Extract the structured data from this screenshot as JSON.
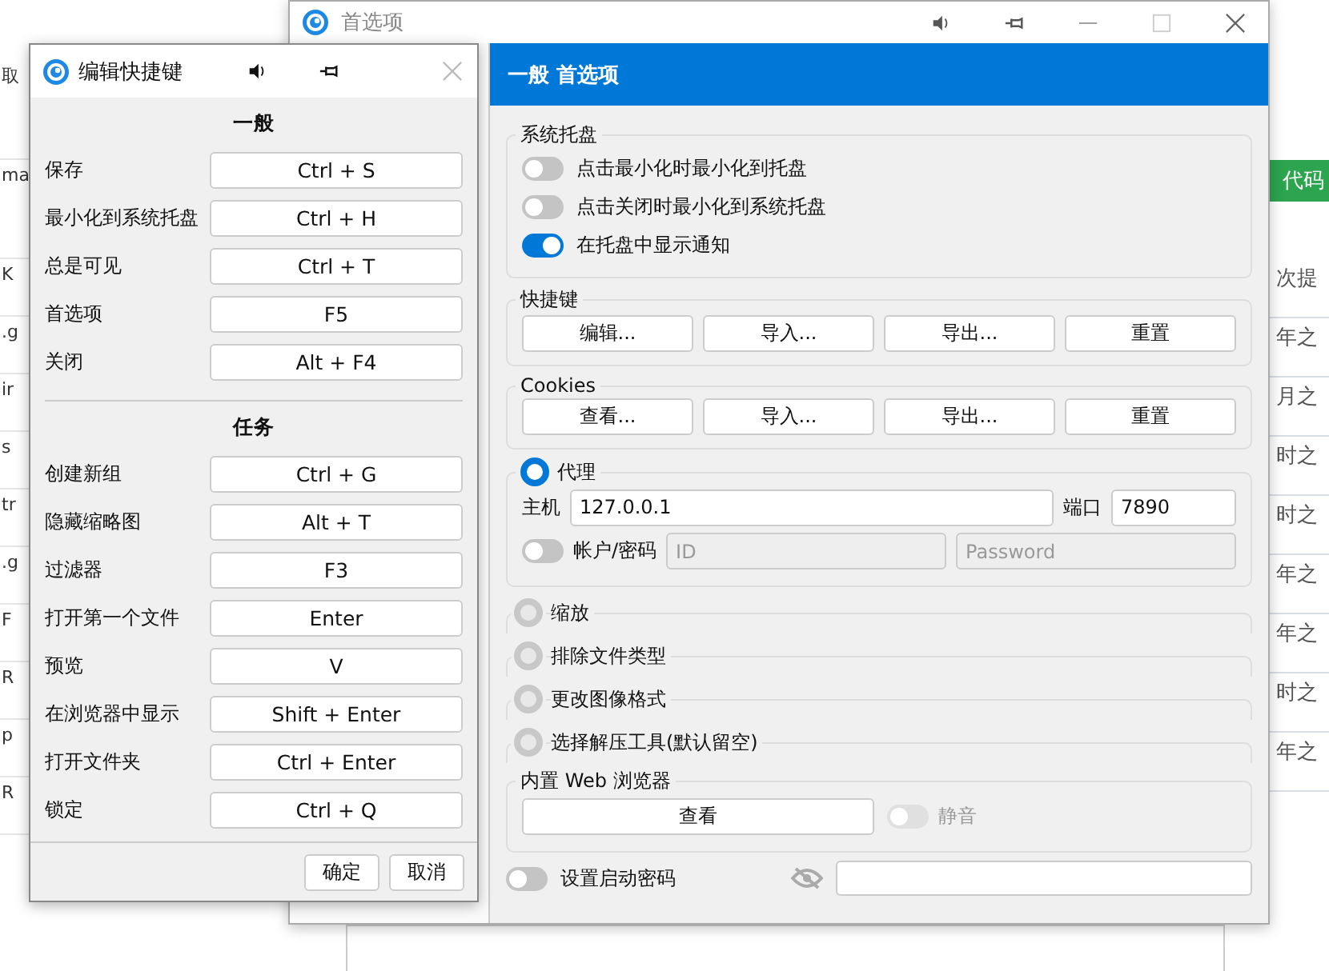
{
  "background_page": {
    "left_fragments": [
      "取",
      "ma",
      "K",
      ".g",
      "ir",
      "s",
      "tr",
      ".g",
      "F",
      "R",
      "p",
      "R"
    ],
    "code_button": "代码",
    "right_fragments": [
      "次提",
      "年之",
      "月之",
      "时之",
      "时之",
      "年之",
      "年之",
      "时之",
      "年之"
    ]
  },
  "preferences_window": {
    "title": "首选项",
    "header": "一般 首选项",
    "groups": [
      {
        "kind": "toggles",
        "legend": "系统托盘",
        "items": [
          {
            "label": "点击最小化时最小化到托盘",
            "on": false
          },
          {
            "label": "点击关闭时最小化到系统托盘",
            "on": false
          },
          {
            "label": "在托盘中显示通知",
            "on": true
          }
        ]
      },
      {
        "kind": "buttons",
        "legend": "快捷键",
        "buttons": [
          "编辑...",
          "导入...",
          "导出...",
          "重置"
        ]
      },
      {
        "kind": "buttons",
        "legend": "Cookies",
        "buttons": [
          "查看...",
          "导入...",
          "导出...",
          "重置"
        ]
      },
      {
        "kind": "proxy",
        "legend": "代理",
        "selected": true,
        "host_label": "主机",
        "host": "127.0.0.1",
        "port_label": "端口",
        "port": "7890",
        "auth": {
          "label": "帐户/密码",
          "on": false
        },
        "id_placeholder": "ID",
        "password_placeholder": "Password"
      },
      {
        "kind": "collapsed",
        "legend": "缩放",
        "selected": false
      },
      {
        "kind": "collapsed",
        "legend": "排除文件类型",
        "selected": false
      },
      {
        "kind": "collapsed",
        "legend": "更改图像格式",
        "selected": false
      },
      {
        "kind": "collapsed",
        "legend": "选择解压工具(默认留空)",
        "selected": false
      },
      {
        "kind": "browser",
        "legend": "内置 Web 浏览器",
        "button": "查看",
        "mute": {
          "label": "静音",
          "on": false,
          "disabled": true
        }
      },
      {
        "kind": "password",
        "label": "设置启动密码",
        "on": false
      }
    ]
  },
  "shortcut_dialog": {
    "title": "编辑快捷键",
    "sections": [
      {
        "heading": "一般",
        "rows": [
          {
            "action": "保存",
            "key": "Ctrl + S"
          },
          {
            "action": "最小化到系统托盘",
            "key": "Ctrl + H"
          },
          {
            "action": "总是可见",
            "key": "Ctrl + T"
          },
          {
            "action": "首选项",
            "key": "F5"
          },
          {
            "action": "关闭",
            "key": "Alt + F4"
          }
        ]
      },
      {
        "heading": "任务",
        "rows": [
          {
            "action": "创建新组",
            "key": "Ctrl + G"
          },
          {
            "action": "隐藏缩略图",
            "key": "Alt + T"
          },
          {
            "action": "过滤器",
            "key": "F3"
          },
          {
            "action": "打开第一个文件",
            "key": "Enter"
          },
          {
            "action": "预览",
            "key": "V"
          },
          {
            "action": "在浏览器中显示",
            "key": "Shift + Enter"
          },
          {
            "action": "打开文件夹",
            "key": "Ctrl + Enter"
          },
          {
            "action": "锁定",
            "key": "Ctrl + Q"
          }
        ]
      }
    ],
    "buttons": [
      "确定",
      "取消"
    ]
  }
}
